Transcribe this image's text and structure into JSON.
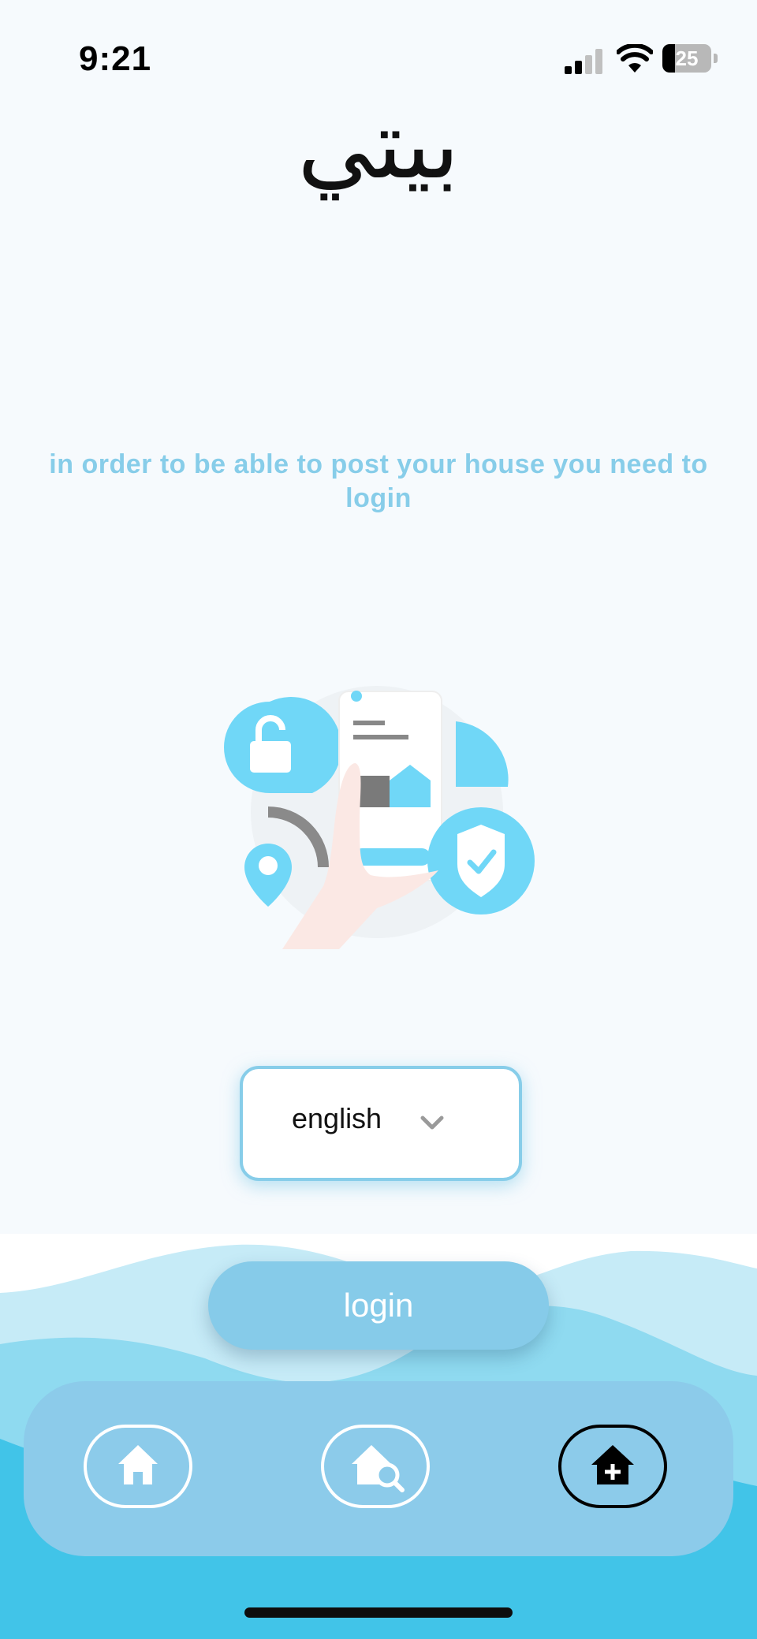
{
  "status_bar": {
    "time": "9:21",
    "battery_level": 25
  },
  "app": {
    "logo_text": "بيتي"
  },
  "main": {
    "info_text": "in order to be able to post your house you need to login",
    "illustration_icon": "phone-house-security-illustration"
  },
  "language_select": {
    "value": "english",
    "icon": "chevron-down-icon"
  },
  "login": {
    "label": "login"
  },
  "nav": {
    "items": [
      {
        "id": "home",
        "icon": "home-icon",
        "active": false
      },
      {
        "id": "search-house",
        "icon": "house-search-icon",
        "active": false
      },
      {
        "id": "add-house",
        "icon": "house-add-icon",
        "active": true
      }
    ]
  },
  "colors": {
    "accent": "#87cde9",
    "background": "#f6fafd",
    "nav_bar": "#8ccbea",
    "wave_light": "#c6ebf7",
    "wave_dark": "#41c4e8",
    "illustration_blue": "#70d7f7"
  }
}
